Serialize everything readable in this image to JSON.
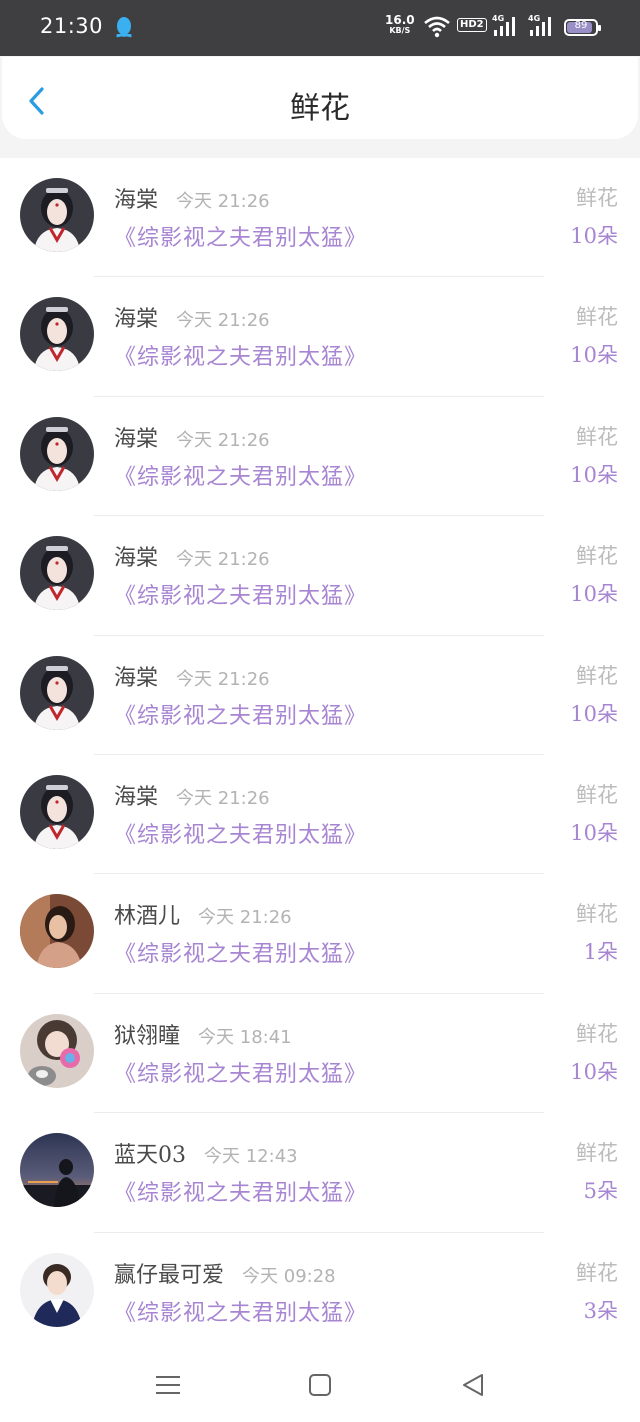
{
  "status_bar": {
    "time": "21:30",
    "net_speed_value": "16.0",
    "net_speed_unit": "KB/S",
    "hd_label": "HD2",
    "sim1_label": "4G",
    "sim2_label": "4G",
    "battery_level": "89"
  },
  "header": {
    "title": "鲜花"
  },
  "items": [
    {
      "name": "海棠",
      "time": "今天 21:26",
      "book": "《综影视之夫君别太猛》",
      "gift": "鲜花",
      "count": "10朵",
      "avatar": "girl-hanfu-avatar"
    },
    {
      "name": "海棠",
      "time": "今天 21:26",
      "book": "《综影视之夫君别太猛》",
      "gift": "鲜花",
      "count": "10朵",
      "avatar": "girl-hanfu-avatar"
    },
    {
      "name": "海棠",
      "time": "今天 21:26",
      "book": "《综影视之夫君别太猛》",
      "gift": "鲜花",
      "count": "10朵",
      "avatar": "girl-hanfu-avatar"
    },
    {
      "name": "海棠",
      "time": "今天 21:26",
      "book": "《综影视之夫君别太猛》",
      "gift": "鲜花",
      "count": "10朵",
      "avatar": "girl-hanfu-avatar"
    },
    {
      "name": "海棠",
      "time": "今天 21:26",
      "book": "《综影视之夫君别太猛》",
      "gift": "鲜花",
      "count": "10朵",
      "avatar": "girl-hanfu-avatar"
    },
    {
      "name": "海棠",
      "time": "今天 21:26",
      "book": "《综影视之夫君别太猛》",
      "gift": "鲜花",
      "count": "10朵",
      "avatar": "girl-hanfu-avatar"
    },
    {
      "name": "林酒儿",
      "time": "今天 21:26",
      "book": "《综影视之夫君别太猛》",
      "gift": "鲜花",
      "count": "1朵",
      "avatar": "woman-warm-avatar"
    },
    {
      "name": "狱翎瞳",
      "time": "今天 18:41",
      "book": "《综影视之夫君别太猛》",
      "gift": "鲜花",
      "count": "10朵",
      "avatar": "girl-cat-avatar"
    },
    {
      "name": "蓝天03",
      "time": "今天 12:43",
      "book": "《综影视之夫君别太猛》",
      "gift": "鲜花",
      "count": "5朵",
      "avatar": "sunset-silhouette-avatar"
    },
    {
      "name": "赢仔最可爱",
      "time": "今天 09:28",
      "book": "《综影视之夫君别太猛》",
      "gift": "鲜花",
      "count": "3朵",
      "avatar": "boy-portrait-avatar"
    }
  ],
  "nav": {
    "menu_icon": "menu-icon",
    "home_icon": "home-square-icon",
    "back_icon": "back-triangle-icon"
  },
  "colors": {
    "accent_purple": "#a785d2",
    "back_blue": "#2b9be3",
    "status_bar": "#3f3f41"
  }
}
